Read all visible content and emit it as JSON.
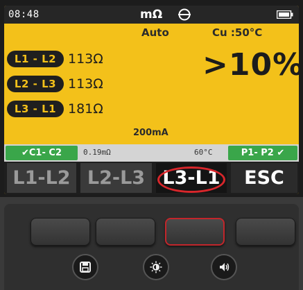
{
  "statusbar": {
    "time": "08:48",
    "unit": "mΩ",
    "range_icon": "range-icon",
    "battery_icon": "battery-icon"
  },
  "measurement": {
    "mode": "Auto",
    "conductor": "Cu :50°C",
    "result": ">10%",
    "rows": [
      {
        "phase": "L1 - L2",
        "value": "113Ω"
      },
      {
        "phase": "L2 - L3",
        "value": "113Ω"
      },
      {
        "phase": "L3 - L1",
        "value": "181Ω"
      }
    ],
    "current": "200mA"
  },
  "infostrip": {
    "left_badge": "✔C1- C2",
    "lead_value": "0.19mΩ",
    "temperature": "60°C",
    "right_badge": "P1- P2 ✔"
  },
  "softkeys": {
    "k1": "L1-L2",
    "k2": "L2-L3",
    "k3": "L3-L1",
    "k4": "ESC",
    "active": "k3"
  },
  "keypad": {
    "colors": {
      "screen_yellow": "#f3c11a",
      "highlight_red": "#d8262b",
      "check_green": "#3aa64a"
    },
    "round_buttons": [
      "save-icon",
      "brightness-icon",
      "speaker-icon"
    ]
  }
}
